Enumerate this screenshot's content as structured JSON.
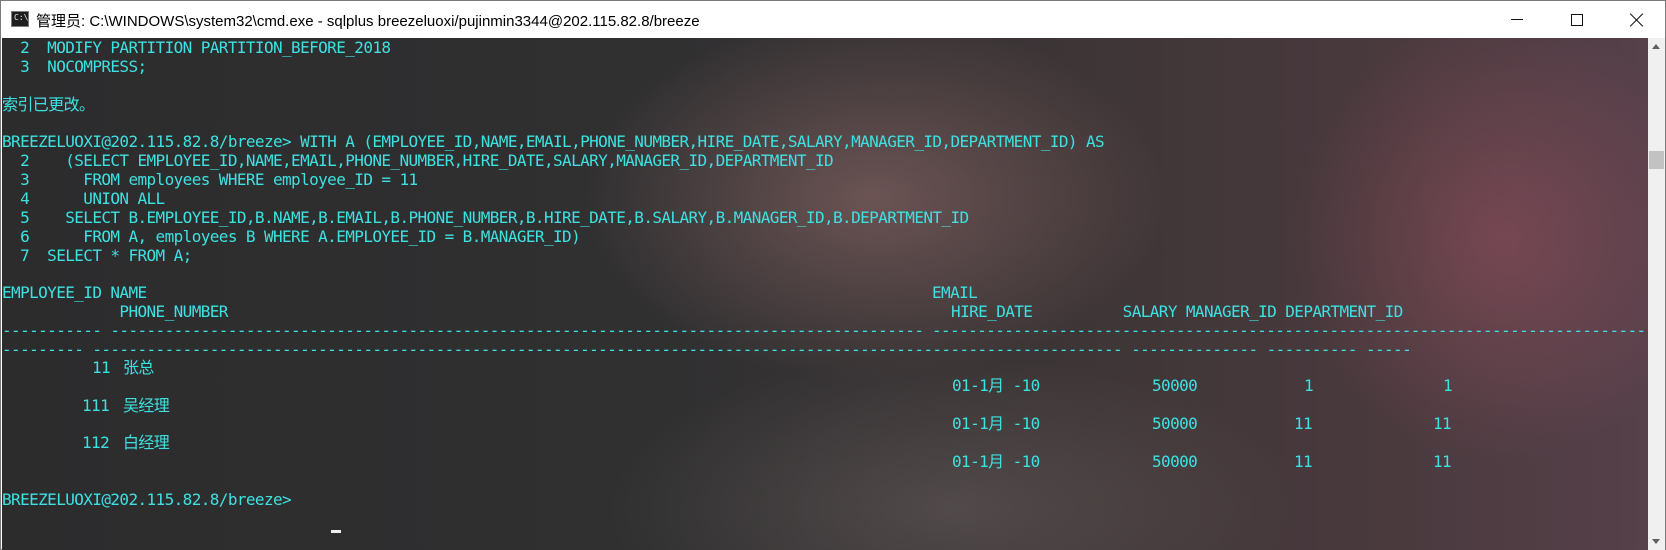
{
  "window": {
    "title": "管理员: C:\\WINDOWS\\system32\\cmd.exe - sqlplus  breezeluoxi/pujinmin3344@202.115.82.8/breeze",
    "icon_text": "C:\\.",
    "controls": [
      "minimize-icon",
      "maximize-icon",
      "close-icon"
    ]
  },
  "colors": {
    "text": "#3ee1e1",
    "background": "#2e2e2f"
  },
  "console": {
    "lines": [
      "  2  MODIFY PARTITION PARTITION_BEFORE_2018",
      "  3  NOCOMPRESS;",
      "",
      "索引已更改。",
      "",
      "BREEZELUOXI@202.115.82.8/breeze> WITH A (EMPLOYEE_ID,NAME,EMAIL,PHONE_NUMBER,HIRE_DATE,SALARY,MANAGER_ID,DEPARTMENT_ID) AS",
      "  2    (SELECT EMPLOYEE_ID,NAME,EMAIL,PHONE_NUMBER,HIRE_DATE,SALARY,MANAGER_ID,DEPARTMENT_ID",
      "  3      FROM employees WHERE employee_ID = 11",
      "  4      UNION ALL",
      "  5    SELECT B.EMPLOYEE_ID,B.NAME,B.EMAIL,B.PHONE_NUMBER,B.HIRE_DATE,B.SALARY,B.MANAGER_ID,B.DEPARTMENT_ID",
      "  6      FROM A, employees B WHERE A.EMPLOYEE_ID = B.MANAGER_ID)",
      "  7  SELECT * FROM A;"
    ],
    "header": {
      "row1_left": "EMPLOYEE_ID NAME",
      "row1_email": "EMAIL",
      "row2_phone": "             PHONE_NUMBER",
      "row2_right": " HIRE_DATE          SALARY MANAGER_ID DEPARTMENT_ID",
      "sep1_left": "----------- ------------------------------------------------------------------------------------------------------------",
      "sep1_right": "----------------------------------------------------------------------------------------------------------------------------------------------------------------",
      "sep2": "--------- ------------------------------------------------------------------------------------------------------------------ -------------- ---------- ---------- -------------"
    },
    "rows": [
      {
        "employee_id": "11",
        "name": "张总",
        "hire_date": "01-1月 -10",
        "salary": "50000",
        "manager_id": "1",
        "department_id": "1"
      },
      {
        "employee_id": "111",
        "name": "吴经理",
        "hire_date": "01-1月 -10",
        "salary": "50000",
        "manager_id": "11",
        "department_id": "11"
      },
      {
        "employee_id": "112",
        "name": "白经理",
        "hire_date": "01-1月 -10",
        "salary": "50000",
        "manager_id": "11",
        "department_id": "11"
      }
    ],
    "prompt": "BREEZELUOXI@202.115.82.8/breeze> "
  }
}
